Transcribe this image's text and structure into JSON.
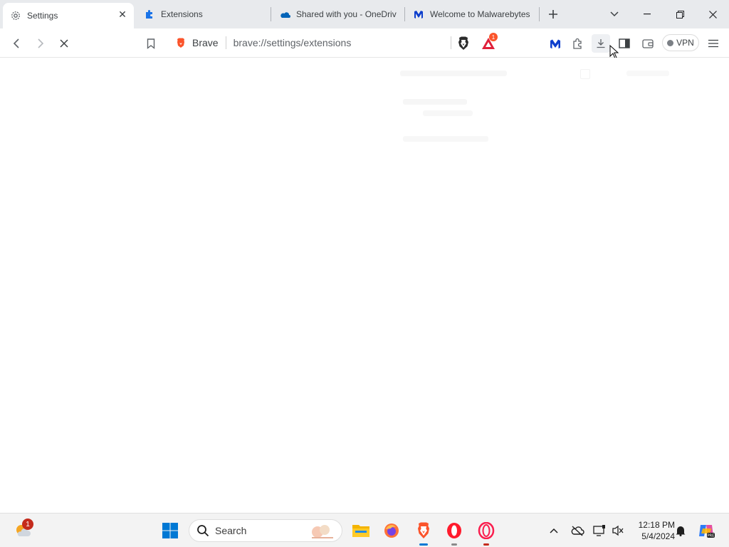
{
  "tabs": [
    {
      "title": "Settings",
      "icon": "gear-icon",
      "active": true
    },
    {
      "title": "Extensions",
      "icon": "puzzle-icon",
      "active": false
    },
    {
      "title": "Shared with you - OneDriv",
      "icon": "onedrive-icon",
      "active": false
    },
    {
      "title": "Welcome to Malwarebytes",
      "icon": "malwarebytes-icon",
      "active": false
    }
  ],
  "toolbar": {
    "site_chip": "Brave",
    "url": "brave://settings/extensions",
    "vpn_label": "VPN",
    "rewards_badge": "1"
  },
  "taskbar": {
    "search_placeholder": "Search",
    "weather_badge": "1",
    "time": "12:18 PM",
    "date": "5/4/2024"
  },
  "colors": {
    "tabstrip_bg": "#e8eaed",
    "brave_orange": "#fb542b",
    "malwarebytes_blue": "#0d3ecc",
    "windows_blue": "#0078d4",
    "opera_red": "#ff1b2d"
  }
}
